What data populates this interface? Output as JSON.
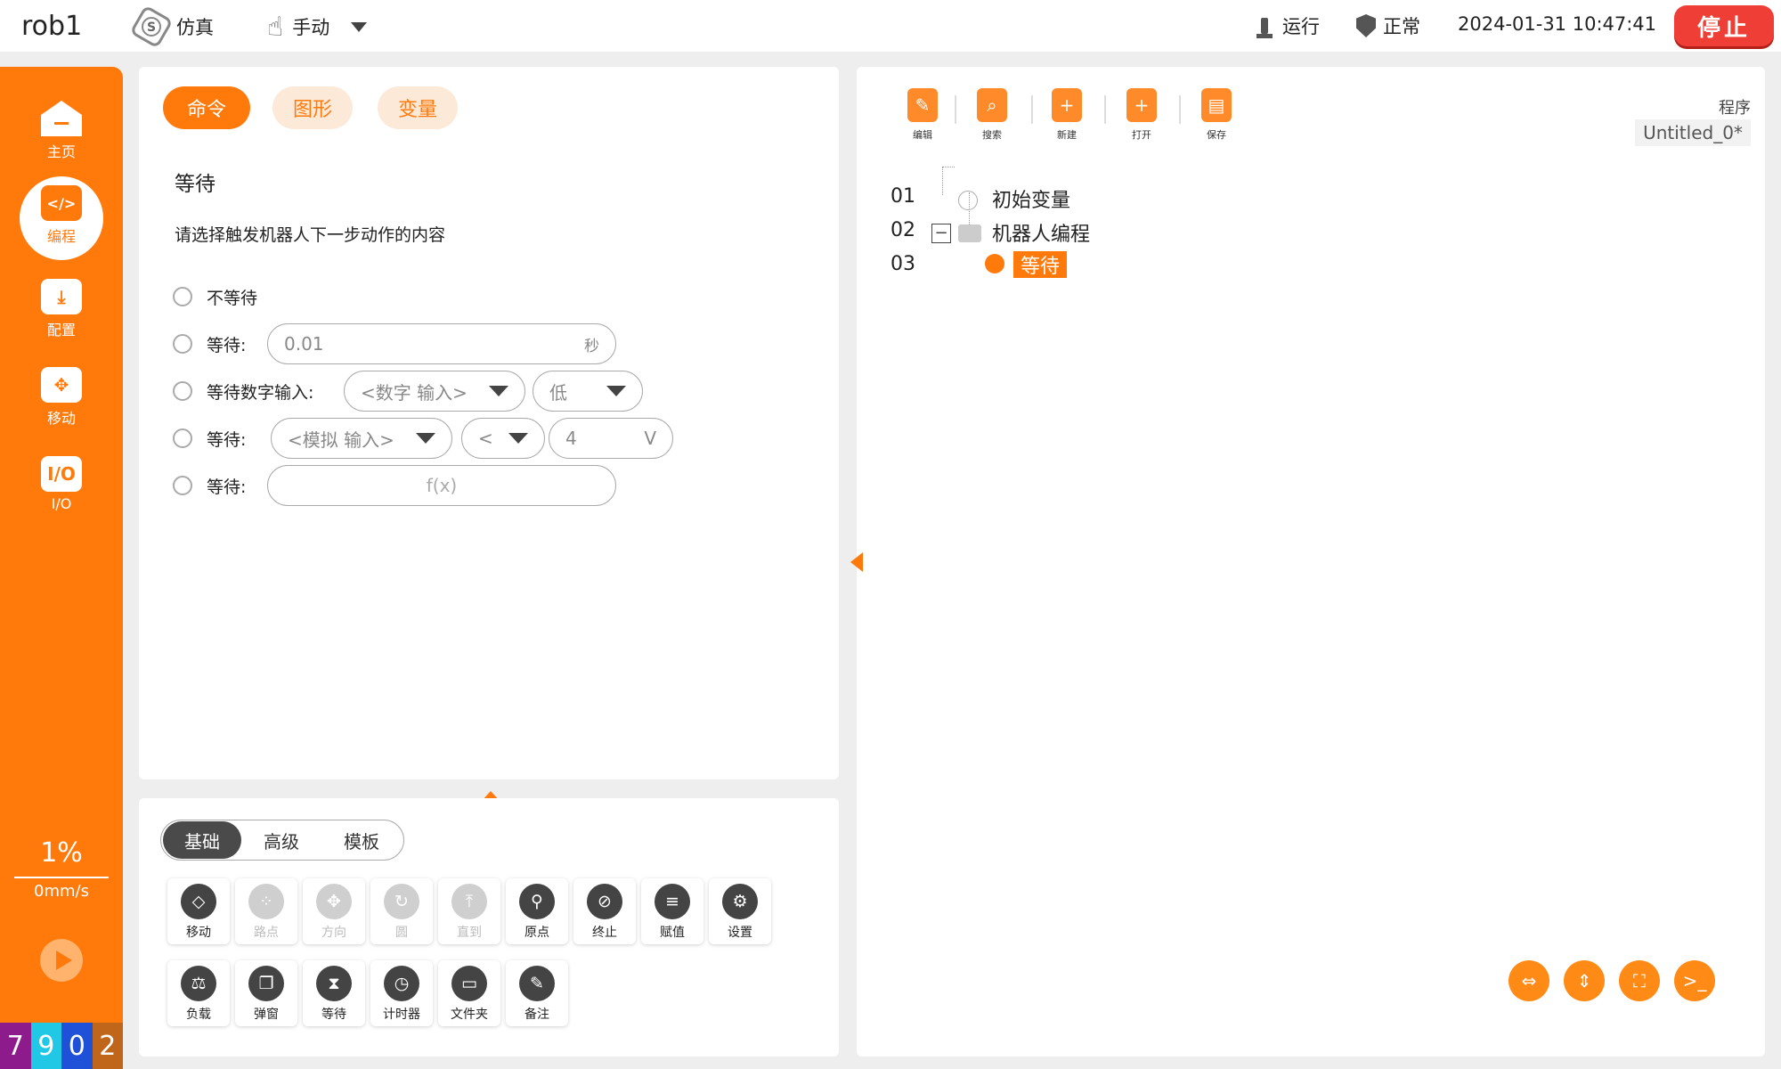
{
  "topbar": {
    "robot_name": "rob1",
    "sim_label": "仿真",
    "mode_label": "手动",
    "status_run": "运行",
    "status_normal": "正常",
    "datetime": "2024-01-31 10:47:41",
    "stop_label": "停止"
  },
  "sidebar": {
    "items": [
      {
        "label": "主页"
      },
      {
        "label": "编程",
        "icon_text": "</>"
      },
      {
        "label": "配置"
      },
      {
        "label": "移动"
      },
      {
        "label": "I/O",
        "icon_text": "I/O"
      }
    ],
    "speed_pct": "1%",
    "speed_mms": "0mm/s",
    "digits": [
      "7",
      "9",
      "0",
      "2"
    ],
    "digit_colors": [
      "#8e1b8c",
      "#20c8e6",
      "#1e50d8",
      "#c0661b"
    ]
  },
  "command_panel": {
    "tabs": [
      "命令",
      "图形",
      "变量"
    ],
    "title": "等待",
    "description": "请选择触发机器人下一步动作的内容",
    "options": {
      "no_wait": "不等待",
      "wait_time_label": "等待:",
      "wait_time_value": "0.01",
      "wait_time_unit": "秒",
      "wait_digital_label": "等待数字输入:",
      "digital_input_placeholder": "<数字 输入>",
      "digital_level": "低",
      "wait_analog_label": "等待:",
      "analog_input_placeholder": "<模拟 输入>",
      "compare_op": "<",
      "analog_value": "4",
      "analog_unit": "V",
      "wait_expr_label": "等待:",
      "expr_placeholder": "f(x)"
    }
  },
  "palette": {
    "segments": [
      "基础",
      "高级",
      "模板"
    ],
    "tools_row1": [
      "移动",
      "路点",
      "方向",
      "圆",
      "直到",
      "原点",
      "终止",
      "赋值",
      "设置"
    ],
    "tools_row2": [
      "负载",
      "弹窗",
      "等待",
      "计时器",
      "文件夹",
      "备注"
    ]
  },
  "program_panel": {
    "toolbar": [
      "编辑",
      "搜索",
      "新建",
      "打开",
      "保存"
    ],
    "program_label": "程序",
    "program_name": "Untitled_0*",
    "lines": [
      "01",
      "02",
      "03"
    ],
    "tree": [
      "初始变量",
      "机器人编程",
      "等待"
    ]
  },
  "colors": {
    "accent": "#ff7a0b",
    "stop": "#ef3e36"
  }
}
